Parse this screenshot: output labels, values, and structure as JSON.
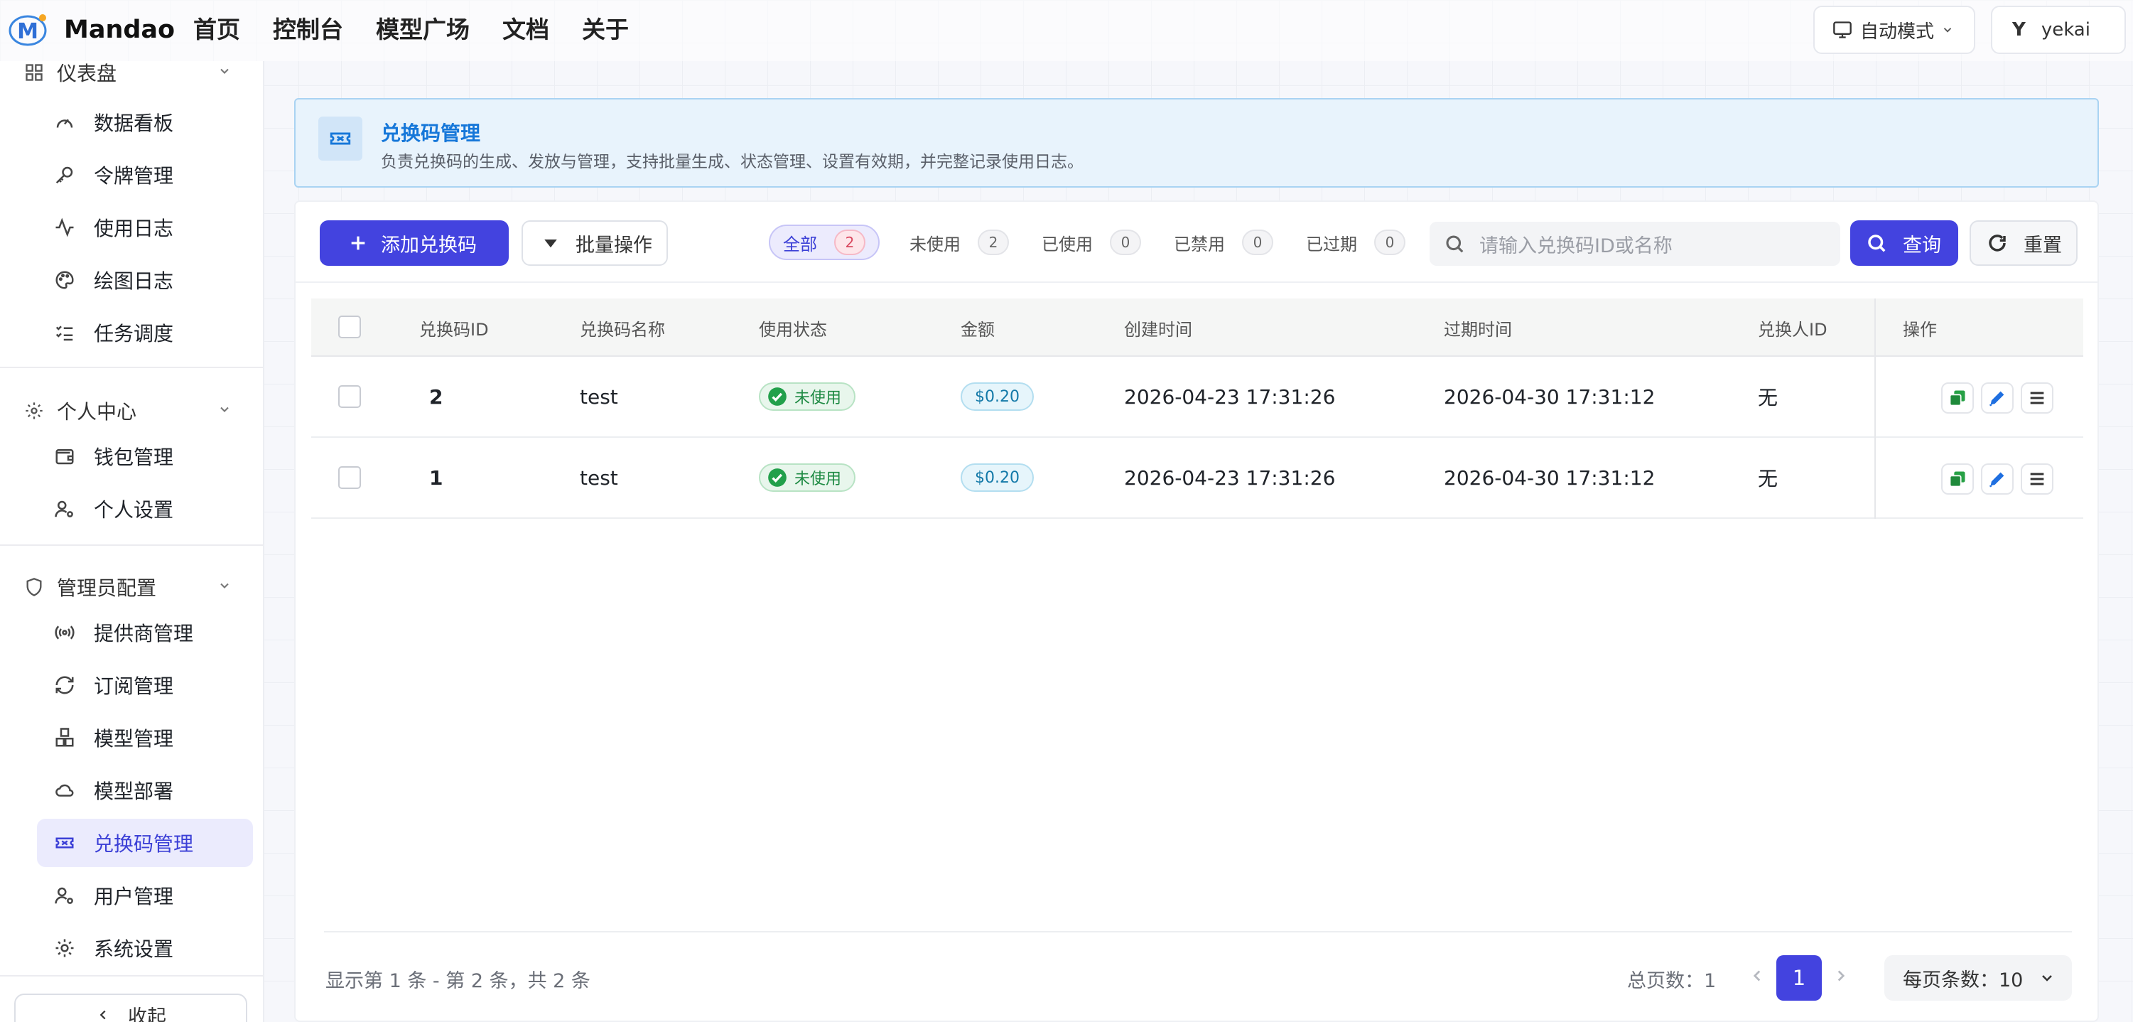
{
  "app": {
    "brand": "Mandao"
  },
  "nav": [
    "首页",
    "控制台",
    "模型广场",
    "文档",
    "关于"
  ],
  "header": {
    "mode_label": "自动模式",
    "user_initial": "Y",
    "user_name": "yekai"
  },
  "sidebar": {
    "dashboard_section": "仪表盘",
    "dashboard_items": [
      {
        "label": "数据看板",
        "icon": "gauge-icon"
      },
      {
        "label": "令牌管理",
        "icon": "key-icon"
      },
      {
        "label": "使用日志",
        "icon": "activity-icon"
      },
      {
        "label": "绘图日志",
        "icon": "palette-icon"
      },
      {
        "label": "任务调度",
        "icon": "list-checks-icon"
      }
    ],
    "personal_section": "个人中心",
    "personal_items": [
      {
        "label": "钱包管理",
        "icon": "wallet-icon"
      },
      {
        "label": "个人设置",
        "icon": "user-settings-icon"
      }
    ],
    "admin_section": "管理员配置",
    "admin_items": [
      {
        "label": "提供商管理",
        "icon": "radio-tower-icon"
      },
      {
        "label": "订阅管理",
        "icon": "refresh-icon"
      },
      {
        "label": "模型管理",
        "icon": "boxes-icon"
      },
      {
        "label": "模型部署",
        "icon": "cloud-icon"
      },
      {
        "label": "兑换码管理",
        "icon": "ticket-icon"
      },
      {
        "label": "用户管理",
        "icon": "user-cog-icon"
      },
      {
        "label": "系统设置",
        "icon": "gear-icon"
      }
    ],
    "collapse_label": "收起"
  },
  "banner": {
    "title": "兑换码管理",
    "description": "负责兑换码的生成、发放与管理，支持批量生成、状态管理、设置有效期，并完整记录使用日志。"
  },
  "toolbar": {
    "add_label": "添加兑换码",
    "batch_label": "批量操作",
    "search_placeholder": "请输入兑换码ID或名称",
    "query_label": "查询",
    "reset_label": "重置"
  },
  "filters": [
    {
      "label": "全部",
      "count": "2"
    },
    {
      "label": "未使用",
      "count": "2"
    },
    {
      "label": "已使用",
      "count": "0"
    },
    {
      "label": "已禁用",
      "count": "0"
    },
    {
      "label": "已过期",
      "count": "0"
    }
  ],
  "table": {
    "columns": [
      "兑换码ID",
      "兑换码名称",
      "使用状态",
      "金额",
      "创建时间",
      "过期时间",
      "兑换人ID",
      "操作"
    ],
    "rows": [
      {
        "id": "2",
        "name": "test",
        "status": "未使用",
        "amount": "$0.20",
        "created": "2026-04-23 17:31:26",
        "expires": "2026-04-30 17:31:12",
        "redeemer": "无"
      },
      {
        "id": "1",
        "name": "test",
        "status": "未使用",
        "amount": "$0.20",
        "created": "2026-04-23 17:31:26",
        "expires": "2026-04-30 17:31:12",
        "redeemer": "无"
      }
    ]
  },
  "pagination": {
    "info": "显示第 1 条 - 第 2 条，共 2 条",
    "total_pages_label": "总页数：1",
    "current_page": "1",
    "per_page_label": "每页条数：10"
  },
  "colors": {
    "primary": "#4343df",
    "success": "#1e8a43",
    "info": "#1677d9"
  }
}
